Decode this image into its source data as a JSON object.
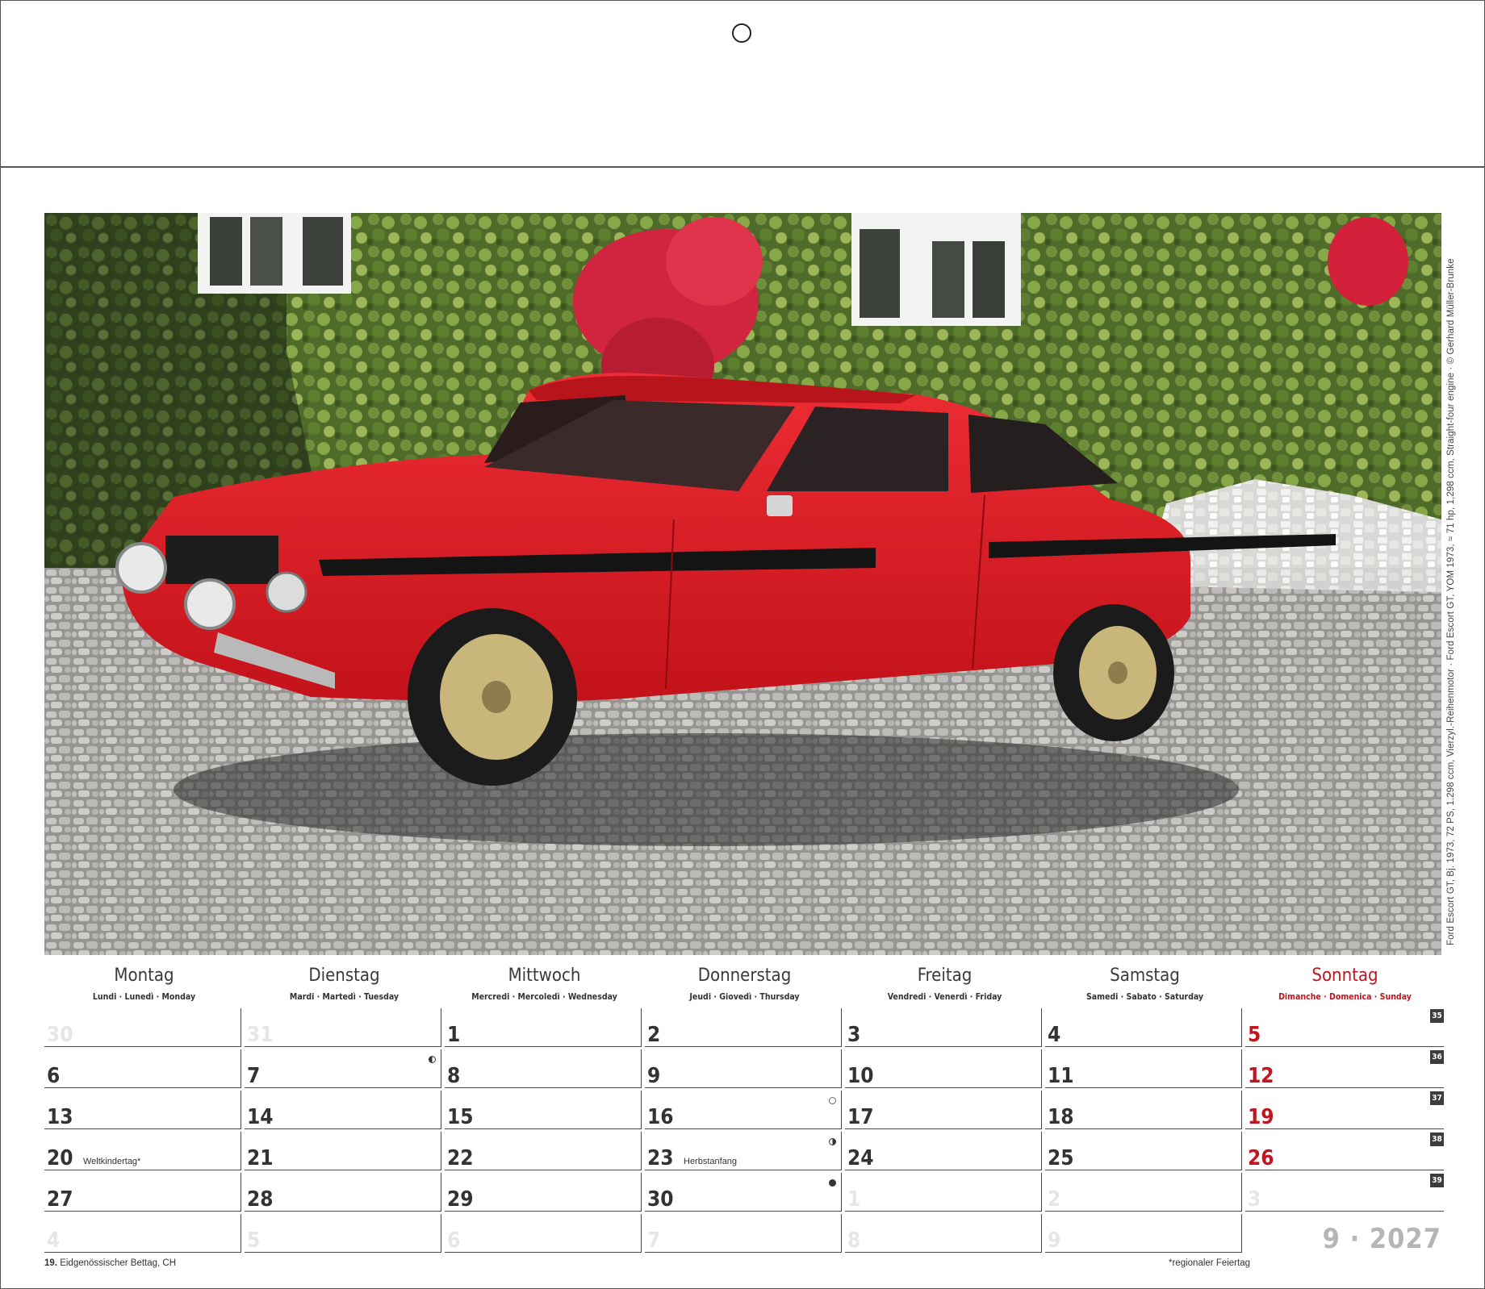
{
  "photo": {
    "alt": "red Ford Escort GT parked on cobblestone courtyard in front of ivy-covered building",
    "caption": "Ford Escort GT, Bj. 1973, 72 PS, 1.298 ccm, Vierzyl.-Reihenmotor · Ford Escort GT, YOM 1973, ≈ 71 hp, 1,298 ccm, Straight-four engine · © Gerhard Müller-Brunke"
  },
  "weekdays": [
    {
      "name": "Montag",
      "sub": "Lundi · Lunedì · Monday"
    },
    {
      "name": "Dienstag",
      "sub": "Mardi · Martedì · Tuesday"
    },
    {
      "name": "Mittwoch",
      "sub": "Mercredi · Mercoledì · Wednesday"
    },
    {
      "name": "Donnerstag",
      "sub": "Jeudi · Giovedì · Thursday"
    },
    {
      "name": "Freitag",
      "sub": "Vendredi · Venerdì · Friday"
    },
    {
      "name": "Samstag",
      "sub": "Samedi · Sabato · Saturday"
    },
    {
      "name": "Sonntag",
      "sub": "Dimanche · Domenica · Sunday"
    }
  ],
  "weeks": [
    {
      "badge": "35",
      "days": [
        {
          "n": "30",
          "state": "outside"
        },
        {
          "n": "31",
          "state": "outside"
        },
        {
          "n": "1"
        },
        {
          "n": "2"
        },
        {
          "n": "3"
        },
        {
          "n": "4"
        },
        {
          "n": "5",
          "state": "sunday"
        }
      ]
    },
    {
      "badge": "36",
      "days": [
        {
          "n": "6"
        },
        {
          "n": "7",
          "moon": "half-last"
        },
        {
          "n": "8"
        },
        {
          "n": "9"
        },
        {
          "n": "10"
        },
        {
          "n": "11"
        },
        {
          "n": "12",
          "state": "sunday"
        }
      ]
    },
    {
      "badge": "37",
      "days": [
        {
          "n": "13"
        },
        {
          "n": "14"
        },
        {
          "n": "15"
        },
        {
          "n": "16",
          "moon": "full"
        },
        {
          "n": "17"
        },
        {
          "n": "18"
        },
        {
          "n": "19",
          "state": "sunday"
        }
      ]
    },
    {
      "badge": "38",
      "days": [
        {
          "n": "20",
          "note": "Weltkindertag*"
        },
        {
          "n": "21"
        },
        {
          "n": "22"
        },
        {
          "n": "23",
          "note": "Herbstanfang",
          "moon": "half-first"
        },
        {
          "n": "24"
        },
        {
          "n": "25"
        },
        {
          "n": "26",
          "state": "sunday"
        }
      ]
    },
    {
      "badge": "39",
      "days": [
        {
          "n": "27"
        },
        {
          "n": "28"
        },
        {
          "n": "29"
        },
        {
          "n": "30",
          "moon": "new"
        },
        {
          "n": "1",
          "state": "outside"
        },
        {
          "n": "2",
          "state": "outside"
        },
        {
          "n": "3",
          "state": "outside"
        }
      ]
    },
    {
      "badge": "",
      "days": [
        {
          "n": "4",
          "state": "outside"
        },
        {
          "n": "5",
          "state": "outside"
        },
        {
          "n": "6",
          "state": "outside"
        },
        {
          "n": "7",
          "state": "outside"
        },
        {
          "n": "8",
          "state": "outside"
        },
        {
          "n": "9",
          "state": "outside"
        }
      ]
    }
  ],
  "footer": {
    "holiday_day": "19.",
    "holiday_text": "Eidgenössischer Bettag, CH",
    "regional_note": "*regionaler Feiertag"
  },
  "month_label": "9 · 2027",
  "colors": {
    "sunday": "#c0161f",
    "grid": "#4a4a4a",
    "badge": "#3d3d3d",
    "faded": "#e6e6e6"
  }
}
